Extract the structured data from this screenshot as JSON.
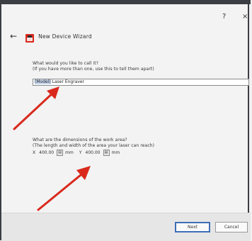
{
  "titlebar": {
    "help": "?",
    "close": "×"
  },
  "header": {
    "back": "←",
    "title": "New Device Wizard"
  },
  "name_section": {
    "question": "What would you like to call it?",
    "hint": "(If you have more than one, use this to tell them apart)",
    "input_value_selected": "(Model)",
    "input_value_rest": " Laser Engraver"
  },
  "dims_section": {
    "question": "What are the dimensions of the work area?",
    "hint": "(The length and width of the area your laser can reach)",
    "x_label": "X",
    "x_value": "400.00",
    "x_unit": "mm",
    "y_label": "Y",
    "y_value": "400.00",
    "y_unit": "mm"
  },
  "footer": {
    "next": "Next",
    "cancel": "Cancel"
  },
  "colors": {
    "accent": "#3e6fb8",
    "arrow": "#d9291c",
    "frame": "#3b3f44"
  },
  "icons": {
    "app": "new-device-icon",
    "back": "back-arrow-icon"
  }
}
